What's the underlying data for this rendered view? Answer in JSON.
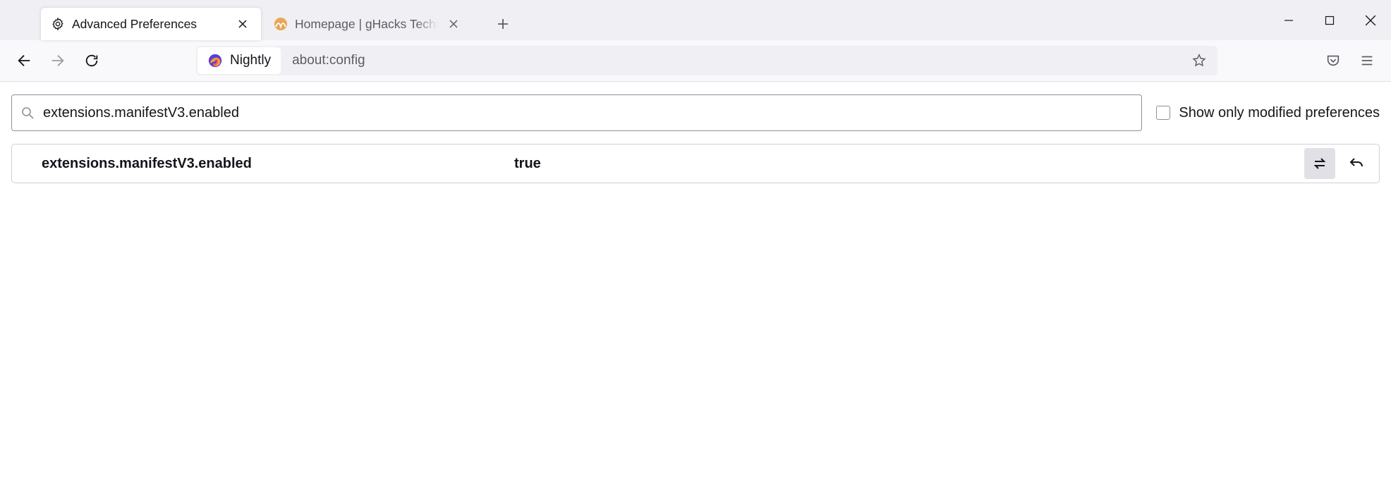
{
  "tabs": [
    {
      "title": "Advanced Preferences",
      "active": true
    },
    {
      "title": "Homepage | gHacks Technology",
      "active": false
    }
  ],
  "addressBar": {
    "identityLabel": "Nightly",
    "url": "about:config"
  },
  "search": {
    "value": "extensions.manifestV3.enabled",
    "checkboxLabel": "Show only modified preferences"
  },
  "preferences": [
    {
      "name": "extensions.manifestV3.enabled",
      "value": "true"
    }
  ]
}
